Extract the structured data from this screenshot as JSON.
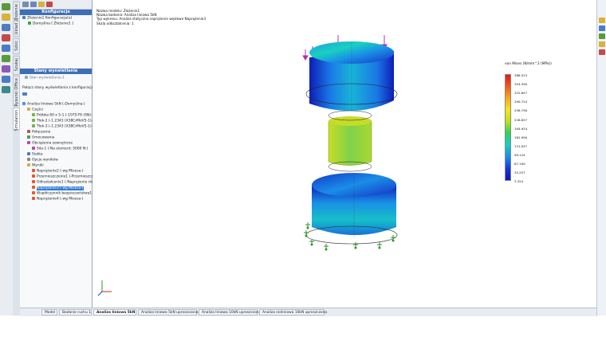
{
  "left_panel": {
    "config_header": "Konfiguracje",
    "config_tree": [
      "Złożenie1 Konfiguracja(e)",
      "Domyślna [ Złożenie1 ]"
    ],
    "display_header": "Stany wyświetlania",
    "display_items": [
      "Stan wyświetlania-1",
      "Połącz stany wyświetlania z konfiguracjami"
    ],
    "study_tree": [
      {
        "label": "Analiza liniowa 5kN (-Domyślna-)",
        "indent": 0,
        "color": "#5b8fd6"
      },
      {
        "label": "Części",
        "indent": 1,
        "color": "#d9a940"
      },
      {
        "label": "Próbka 60 x 5-1 (-1075-T6 (SN)-)",
        "indent": 2,
        "color": "#7ab04b"
      },
      {
        "label": "Tłok-2 (-1.2343 (X38CrMoV5-1)-)",
        "indent": 2,
        "color": "#7ab04b"
      },
      {
        "label": "Tłok-3 (-1.2343 (X38CrMoV5-1)-)",
        "indent": 2,
        "color": "#7ab04b"
      },
      {
        "label": "Połączenia",
        "indent": 1,
        "color": "#c05050"
      },
      {
        "label": "Umocowania",
        "indent": 1,
        "color": "#4a9a4a"
      },
      {
        "label": "Obciążenia zewnętrzne",
        "indent": 1,
        "color": "#b04ab0"
      },
      {
        "label": "Siła-1 (:Na element: 5000 N:)",
        "indent": 2,
        "color": "#b04ab0"
      },
      {
        "label": "Siatka",
        "indent": 1,
        "color": "#4a7ac0"
      },
      {
        "label": "Opcje wyników",
        "indent": 1,
        "color": "#888888"
      },
      {
        "label": "Wyniki",
        "indent": 1,
        "color": "#d9a940"
      },
      {
        "label": "Naprężenie2 (-wg Misesa-)",
        "indent": 2,
        "color": "#e05a2a"
      },
      {
        "label": "Przemieszczenie1 (-Przemieszczenie-)",
        "indent": 2,
        "color": "#e05a2a"
      },
      {
        "label": "Odkształcenie1 (-Naprężenie równoważne-)",
        "indent": 2,
        "color": "#e05a2a"
      },
      {
        "label": "Naprężenie3 (-wg Misesa-)",
        "indent": 2,
        "color": "#e05a2a",
        "selected": true
      },
      {
        "label": "Współczynnik bezpieczeństwa1 (-Max von Mises-)",
        "indent": 2,
        "color": "#e05a2a"
      },
      {
        "label": "Naprężenie4 (-wg Misesa-)",
        "indent": 2,
        "color": "#e05a2a"
      }
    ]
  },
  "vertical_tabs": [
    "Simulation",
    "Rysunki Office",
    "Szukaj",
    "Szkic",
    "Układ",
    "Złożenie"
  ],
  "study_info": [
    "Nazwa modelu: Złożenie1",
    "Nazwa badania: Analiza liniowa 5kN",
    "Typ wykresu: Analiza statyczna naprężenie węzłowe Naprężenie3",
    "Skala odkształcenia: 1"
  ],
  "legend": {
    "title": "von Mises (N/mm^2 (MPa))",
    "values": [
      "386.523",
      "354.390",
      "322.657",
      "290.724",
      "258.790",
      "226.857",
      "194.924",
      "162.990",
      "131.057",
      "99.124",
      "67.190",
      "35.257",
      "3.324"
    ]
  },
  "bottom_tabs": [
    {
      "label": "Model",
      "active": false
    },
    {
      "label": "Badanie ruchu 1",
      "active": false
    },
    {
      "label": "Analiza liniowa 5kN",
      "active": true
    },
    {
      "label": "Analiza liniowa 5kN uproszczona",
      "active": false
    },
    {
      "label": "Analiza liniowa 10kN uproszczona",
      "active": false
    },
    {
      "label": "Analiza nieliniowa 10kN uproszczona",
      "active": false
    }
  ],
  "colors": {
    "header_blue": "#3f6fb6",
    "selection_blue": "#2f7bd9"
  }
}
